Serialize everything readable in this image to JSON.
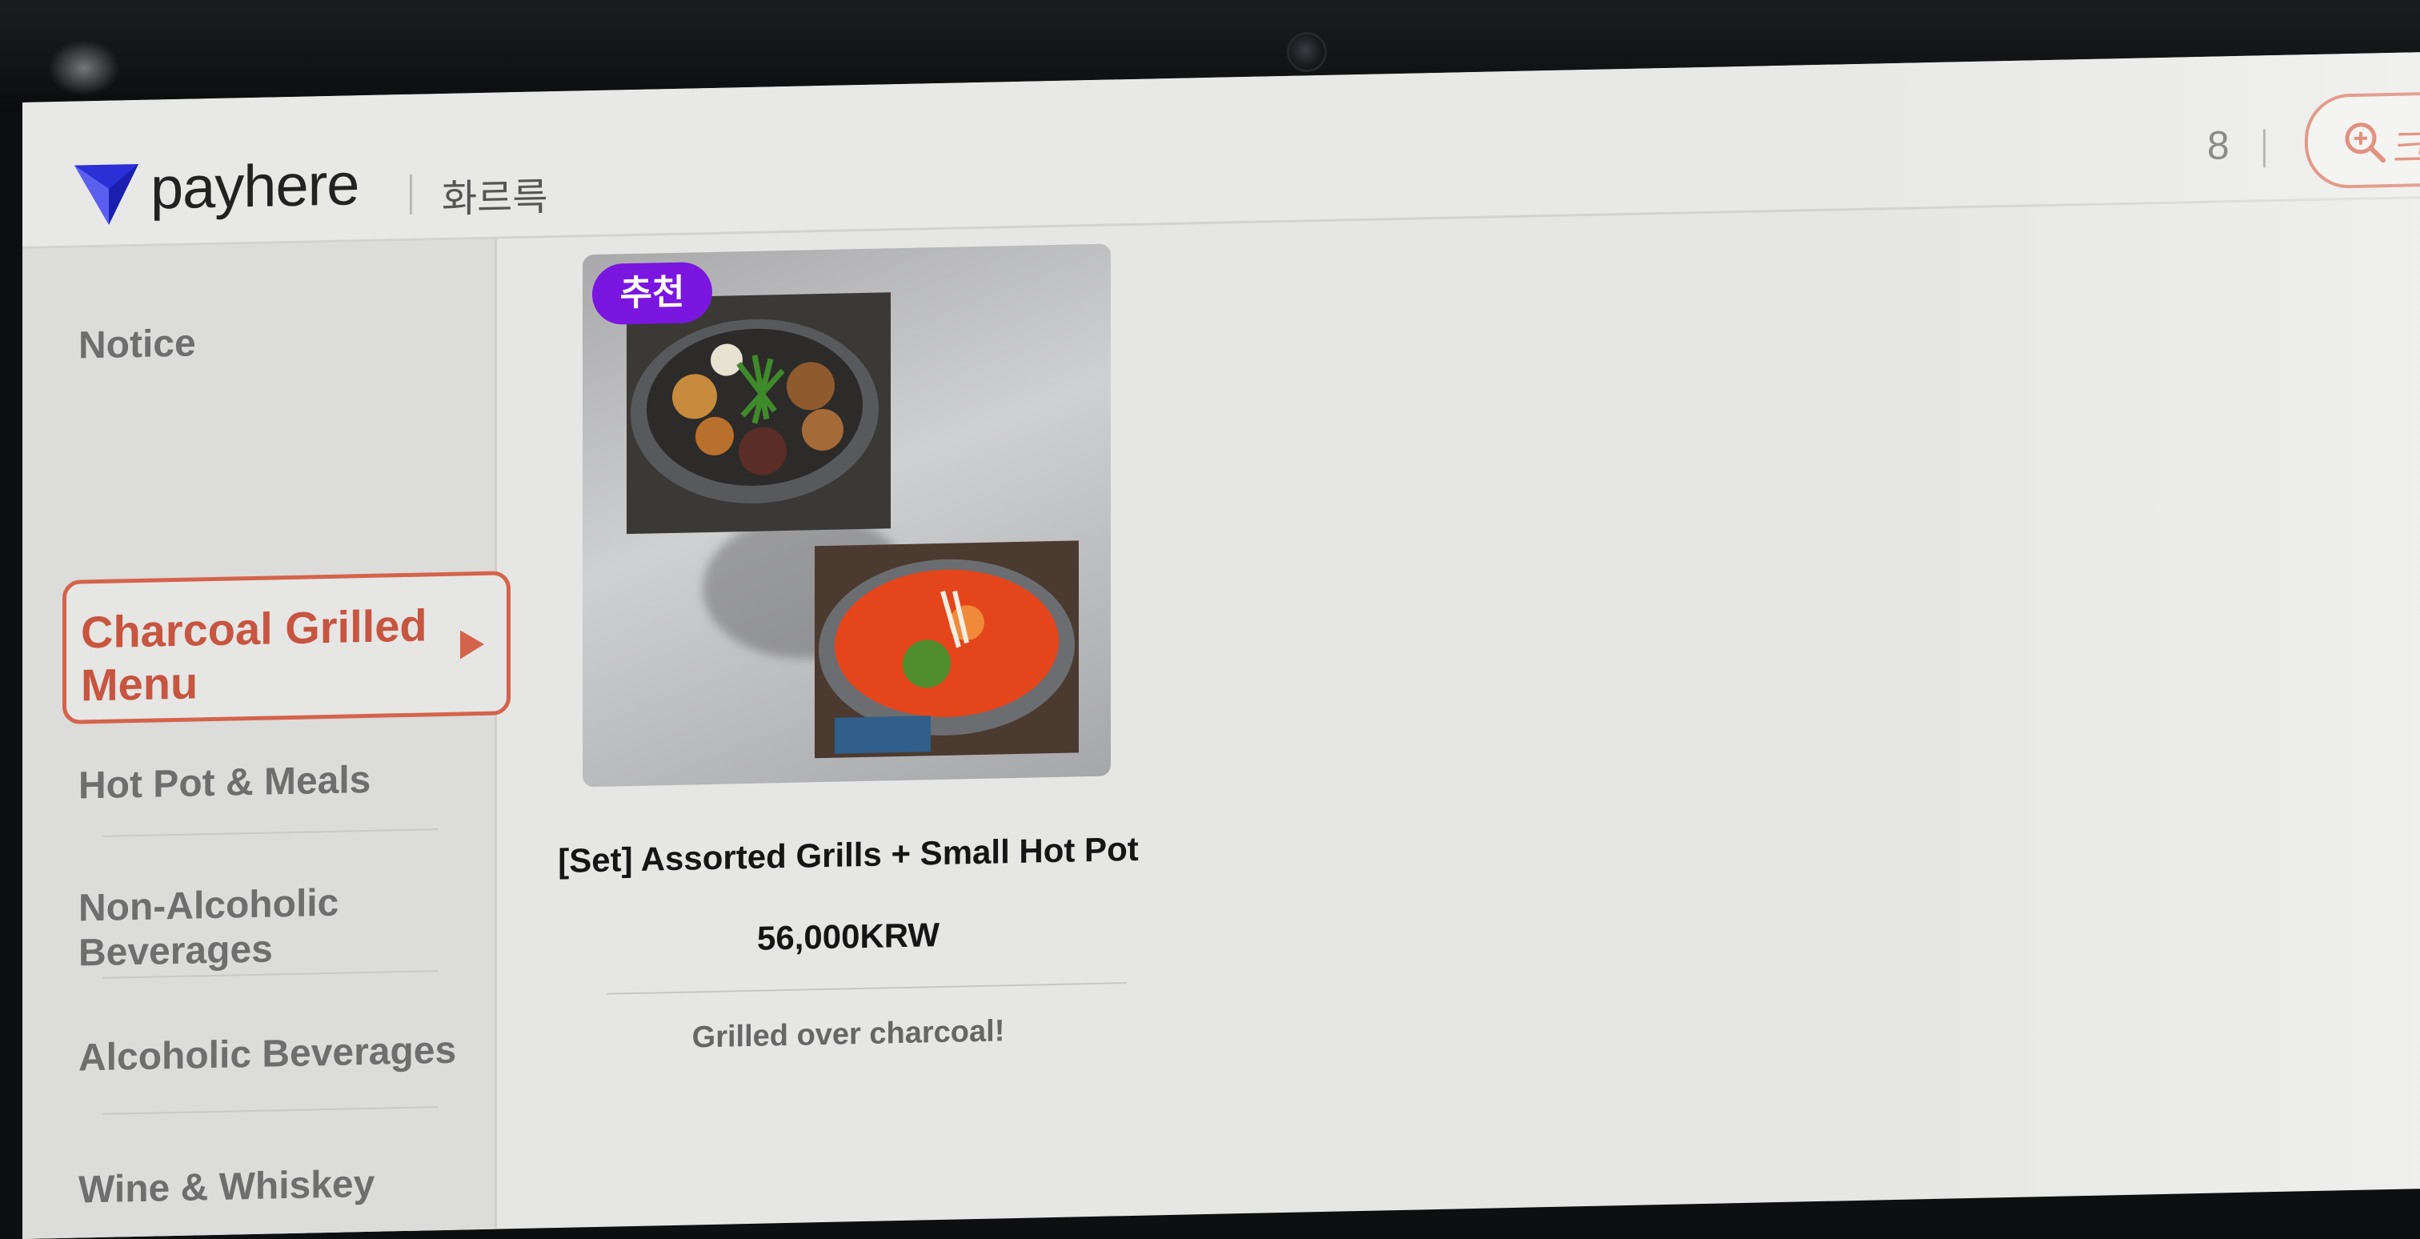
{
  "header": {
    "brand": "payhere",
    "store_name": "화르륵",
    "table_number": "8",
    "zoom_label": "크"
  },
  "sidebar": {
    "items": [
      {
        "label": "Notice",
        "active": false
      },
      {
        "label": "Charcoal Grilled Menu",
        "active": true
      },
      {
        "label": "Hot Pot & Meals",
        "active": false
      },
      {
        "label": "Non-Alcoholic Beverages",
        "active": false
      },
      {
        "label": "Alcoholic Beverages",
        "active": false
      },
      {
        "label": "Wine & Whiskey",
        "active": false
      }
    ]
  },
  "products": [
    {
      "badge": "추천",
      "name": "[Set] Assorted Grills + Small Hot Pot",
      "price": "56,000KRW",
      "description": "Grilled over charcoal!"
    }
  ],
  "colors": {
    "accent": "#d4634b",
    "badge": "#7a16e0",
    "brand_logo": "#2b2fd6"
  }
}
